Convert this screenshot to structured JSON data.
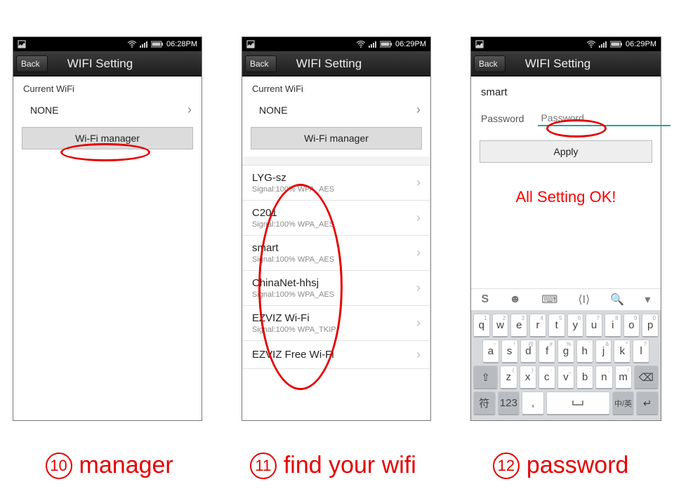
{
  "status": {
    "time1": "06:28PM",
    "time2": "06:29PM",
    "time3": "06:29PM"
  },
  "nav": {
    "back": "Back",
    "title": "WIFI Setting"
  },
  "panel1": {
    "current_label": "Current WiFi",
    "current_value": "NONE",
    "manager_btn": "Wi-Fi manager"
  },
  "panel2": {
    "current_label": "Current WiFi",
    "current_value": "NONE",
    "manager_btn": "Wi-Fi manager",
    "networks": [
      {
        "name": "LYG-sz",
        "sub": "Signal:100%   WPA_AES"
      },
      {
        "name": "C201",
        "sub": "Signal:100%   WPA_AES"
      },
      {
        "name": "smart",
        "sub": "Signal:100%   WPA_AES"
      },
      {
        "name": "ChinaNet-hhsj",
        "sub": "Signal:100%   WPA_AES"
      },
      {
        "name": "EZVIZ Wi-Fi",
        "sub": "Signal:100%   WPA_TKIP"
      },
      {
        "name": "EZVIZ Free Wi-Fi",
        "sub": ""
      }
    ]
  },
  "panel3": {
    "ssid": "smart",
    "pw_label": "Password",
    "pw_placeholder": "Password",
    "apply_btn": "Apply",
    "ok_banner": "All Setting OK!"
  },
  "keyboard": {
    "row1": [
      "q",
      "w",
      "e",
      "r",
      "t",
      "y",
      "u",
      "i",
      "o",
      "p"
    ],
    "row1_alt": [
      "1",
      "2",
      "3",
      "4",
      "5",
      "6",
      "7",
      "8",
      "9",
      "0"
    ],
    "row2": [
      "a",
      "s",
      "d",
      "f",
      "g",
      "h",
      "j",
      "k",
      "l"
    ],
    "row2_alt": [
      "~",
      "!",
      "@",
      "#",
      "%",
      "'",
      "&",
      "*",
      "?"
    ],
    "row3": [
      "z",
      "x",
      "c",
      "v",
      "b",
      "n",
      "m"
    ],
    "row3_alt": [
      "(",
      ")",
      "-",
      "_",
      ":",
      ";",
      "/"
    ],
    "shift": "⇧",
    "del": "⌫",
    "row4_sym": "符",
    "row4_num": "123",
    "row4_comma": ",",
    "row4_lang": "中/英"
  },
  "captions": {
    "n1": "10",
    "t1": "manager",
    "n2": "11",
    "t2": "find  your wifi",
    "n3": "12",
    "t3": "password"
  }
}
